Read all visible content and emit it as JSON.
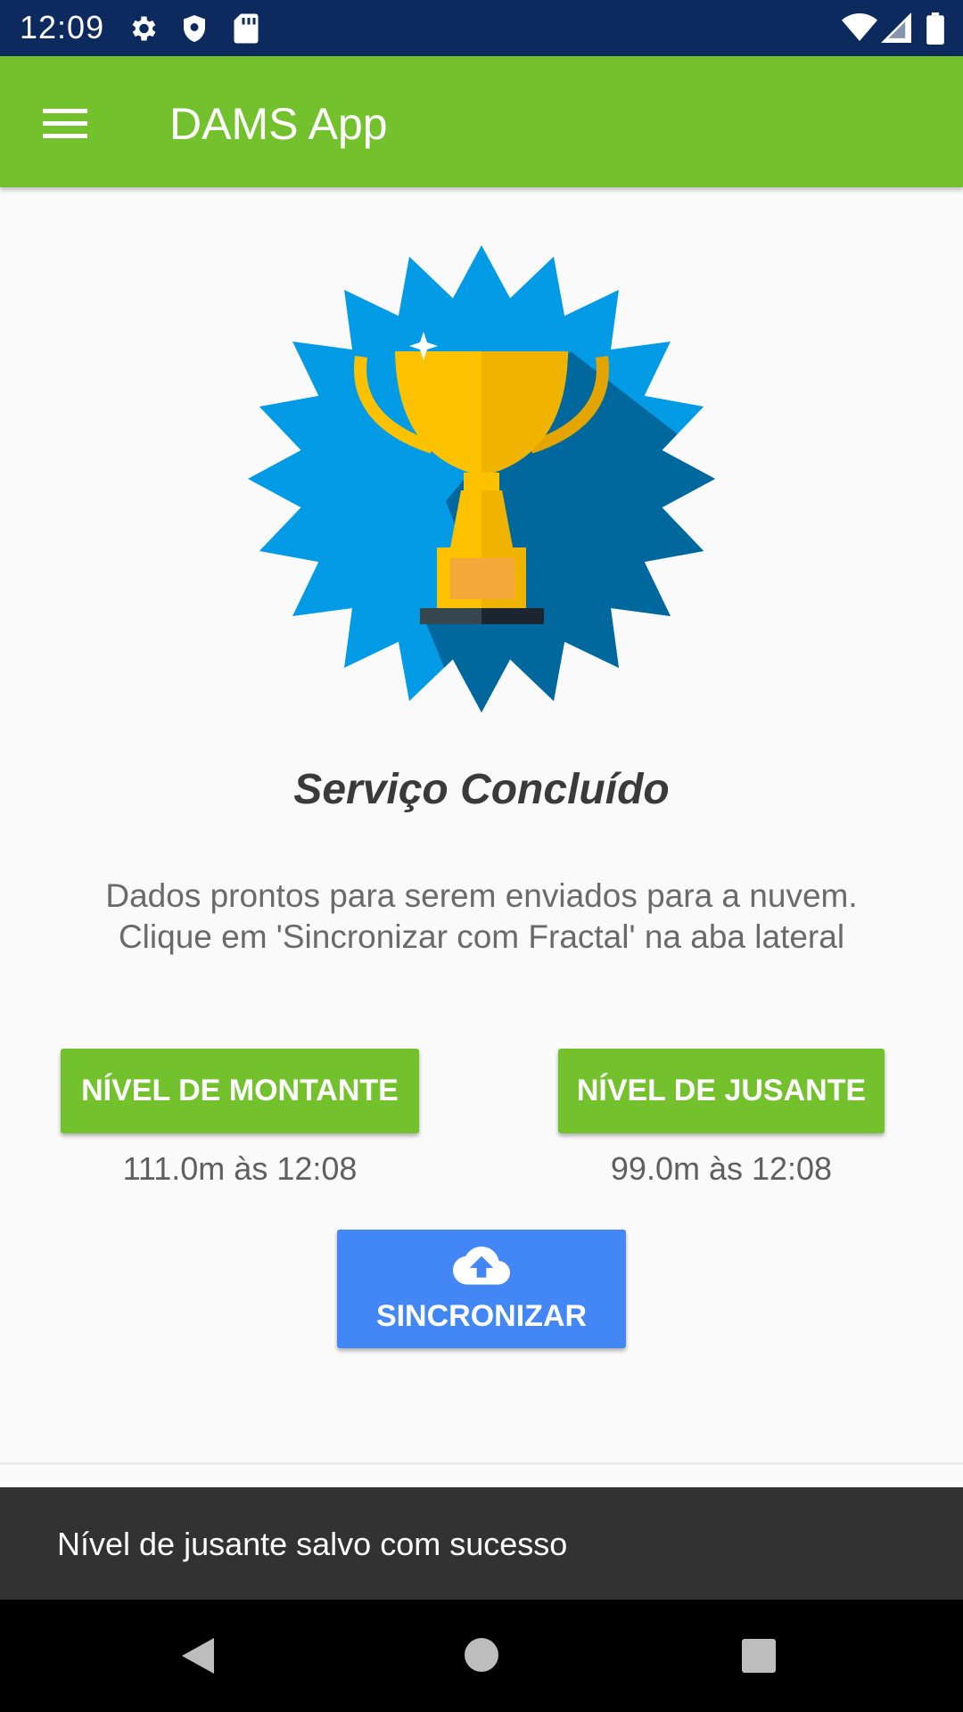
{
  "status_bar": {
    "time": "12:09",
    "icons": [
      "gear-icon",
      "shield-icon",
      "sd-card-icon",
      "wifi-icon",
      "signal-icon",
      "battery-icon"
    ]
  },
  "app_bar": {
    "title": "DAMS App",
    "menu_icon": "hamburger-menu-icon",
    "color": "#73c22d"
  },
  "main": {
    "image": "trophy-badge",
    "title": "Serviço Concluído",
    "description": "Dados prontos para serem enviados para a nuvem. Clique em 'Sincronizar com Fractal' na aba lateral",
    "upstream": {
      "button_label": "NÍVEL DE MONTANTE",
      "value": "111.0m às 12:08"
    },
    "downstream": {
      "button_label": "NÍVEL DE JUSANTE",
      "value": "99.0m às 12:08"
    },
    "sync": {
      "icon": "cloud-upload-icon",
      "label": "SINCRONIZAR",
      "color": "#4287f5"
    }
  },
  "snackbar": {
    "message": "Nível de jusante salvo com sucesso"
  },
  "nav_bar": {
    "buttons": [
      "back-icon",
      "home-icon",
      "recents-icon"
    ]
  },
  "colors": {
    "status_bar": "#0d2a5e",
    "accent_green": "#73c22d",
    "badge_blue": "#039be5",
    "trophy_gold": "#fcc200"
  }
}
